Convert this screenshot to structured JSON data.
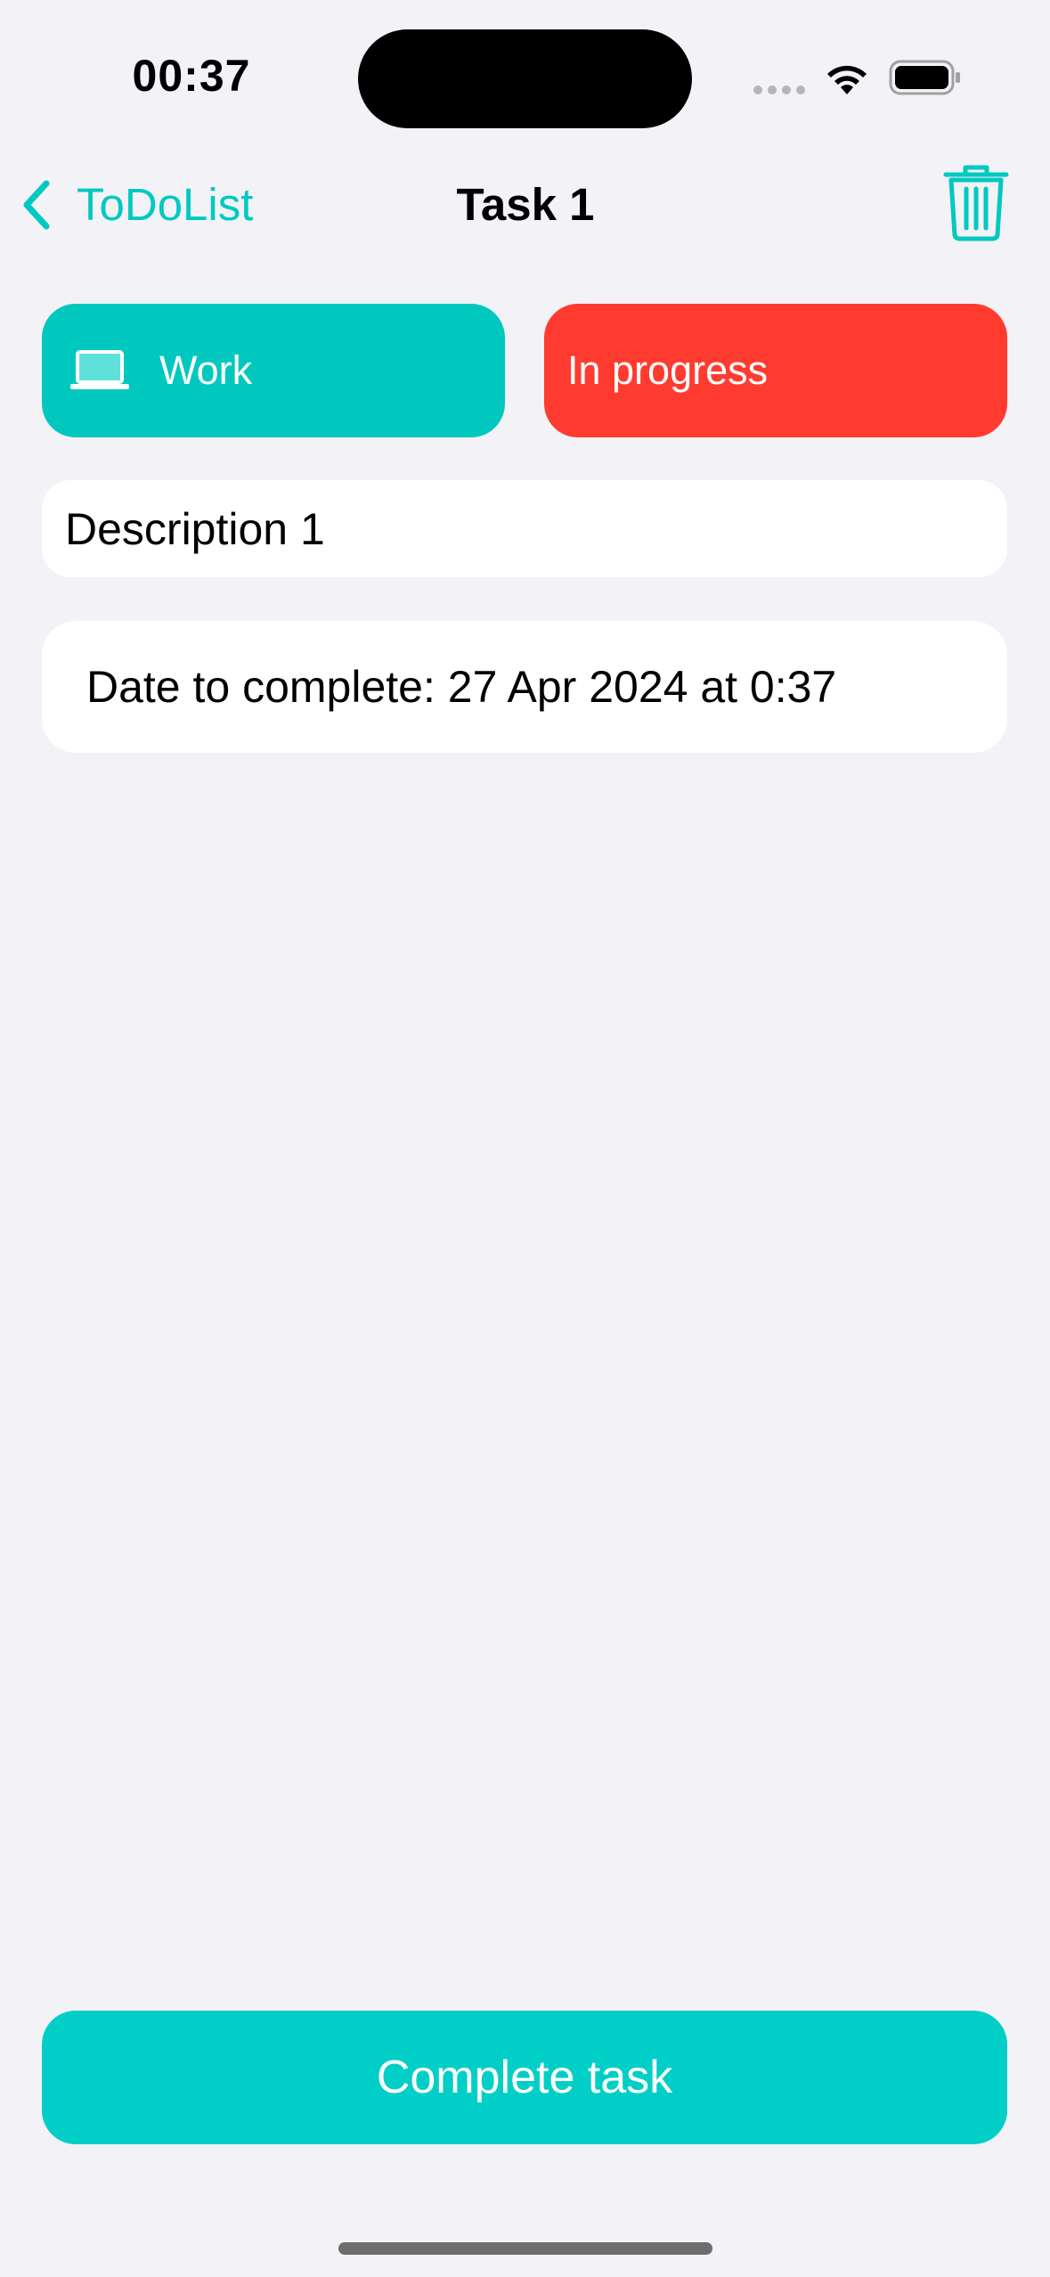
{
  "status_bar": {
    "time": "00:37"
  },
  "nav": {
    "back_label": "ToDoList",
    "title": "Task 1",
    "trash_icon": "trash-icon",
    "back_icon": "chevron-left-icon"
  },
  "task": {
    "category_label": "Work",
    "category_icon": "laptop-icon",
    "status_label": "In progress",
    "description": "Description 1",
    "date_text": "Date to complete: 27 Apr 2024 at 0:37"
  },
  "actions": {
    "complete_label": "Complete task"
  },
  "colors": {
    "accent": "#00c8bf",
    "status_in_progress": "#ff3b30",
    "background": "#f2f2f7"
  }
}
